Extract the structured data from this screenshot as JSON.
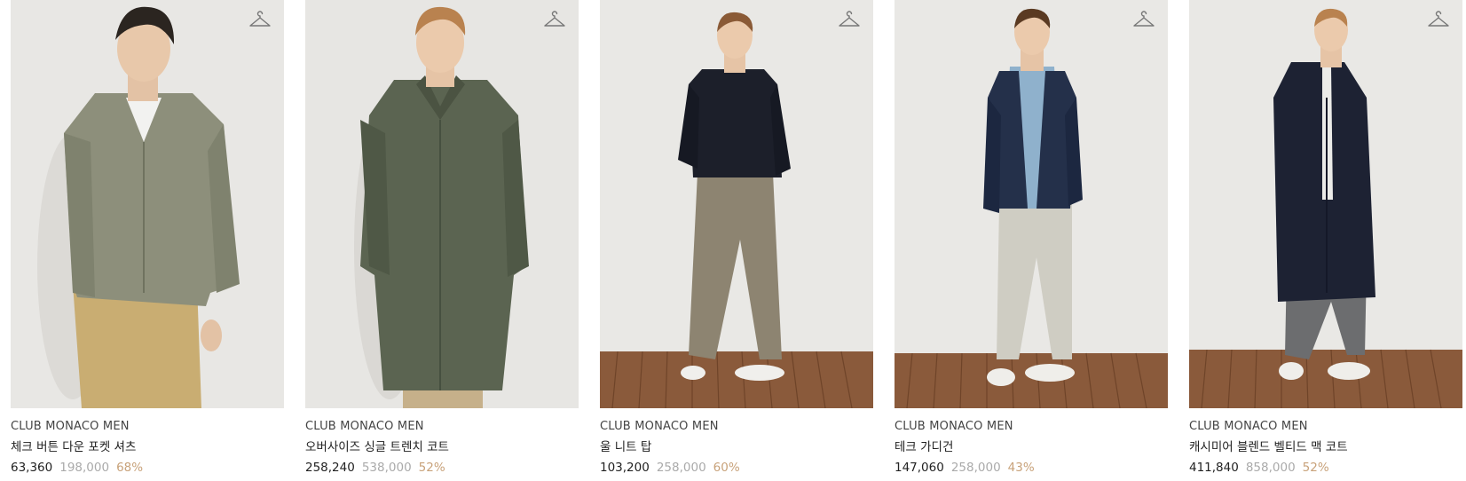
{
  "products": [
    {
      "brand": "CLUB MONACO MEN",
      "name": "체크 버튼 다운 포켓 셔츠",
      "price": "63,360",
      "original_price": "198,000",
      "discount": "68%",
      "wishlist_icon": "hanger-icon"
    },
    {
      "brand": "CLUB MONACO MEN",
      "name": "오버사이즈 싱글 트렌치 코트",
      "price": "258,240",
      "original_price": "538,000",
      "discount": "52%",
      "wishlist_icon": "hanger-icon"
    },
    {
      "brand": "CLUB MONACO MEN",
      "name": "울 니트 탑",
      "price": "103,200",
      "original_price": "258,000",
      "discount": "60%",
      "wishlist_icon": "hanger-icon"
    },
    {
      "brand": "CLUB MONACO MEN",
      "name": "테크 가디건",
      "price": "147,060",
      "original_price": "258,000",
      "discount": "43%",
      "wishlist_icon": "hanger-icon"
    },
    {
      "brand": "CLUB MONACO MEN",
      "name": "캐시미어 블렌드 벨티드 맥 코트",
      "price": "411,840",
      "original_price": "858,000",
      "discount": "52%",
      "wishlist_icon": "hanger-icon"
    }
  ],
  "colors": {
    "wall": "#e6e4e1",
    "floor": "#8a5a3b",
    "discount": "#c8a27a",
    "original_price": "#aaaaaa"
  }
}
